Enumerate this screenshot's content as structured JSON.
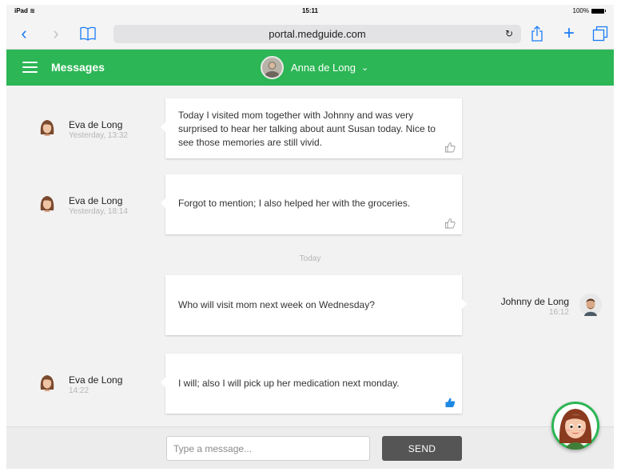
{
  "status_bar": {
    "device": "iPad",
    "time": "15:11",
    "battery": "100%"
  },
  "browser": {
    "url": "portal.medguide.com"
  },
  "app_bar": {
    "title": "Messages",
    "current_user": "Anna de Long"
  },
  "messages": [
    {
      "sender": "Eva de Long",
      "time": "Yesterday, 13:32",
      "text": "Today I visited mom together with Johnny and was very surprised to hear her talking about aunt Susan today. Nice to see those memories are still vivid.",
      "liked": false
    },
    {
      "sender": "Eva de Long",
      "time": "Yesterday, 18:14",
      "text": "Forgot to mention; I also helped her with the groceries.",
      "liked": false
    },
    {
      "sender": "Johnny de Long",
      "time": "16:12",
      "text": "Who will visit mom next week on Wednesday?",
      "liked": false
    },
    {
      "sender": "Eva de Long",
      "time": "14:22",
      "text": "I will; also I will pick up her medication next monday.",
      "liked": true
    }
  ],
  "day_divider": "Today",
  "composer": {
    "placeholder": "Type a message...",
    "send_label": "SEND"
  },
  "colors": {
    "brand_green": "#2cb655",
    "ios_blue": "#1a7cf5",
    "like_blue": "#1e88e5",
    "send_button": "#555556"
  }
}
